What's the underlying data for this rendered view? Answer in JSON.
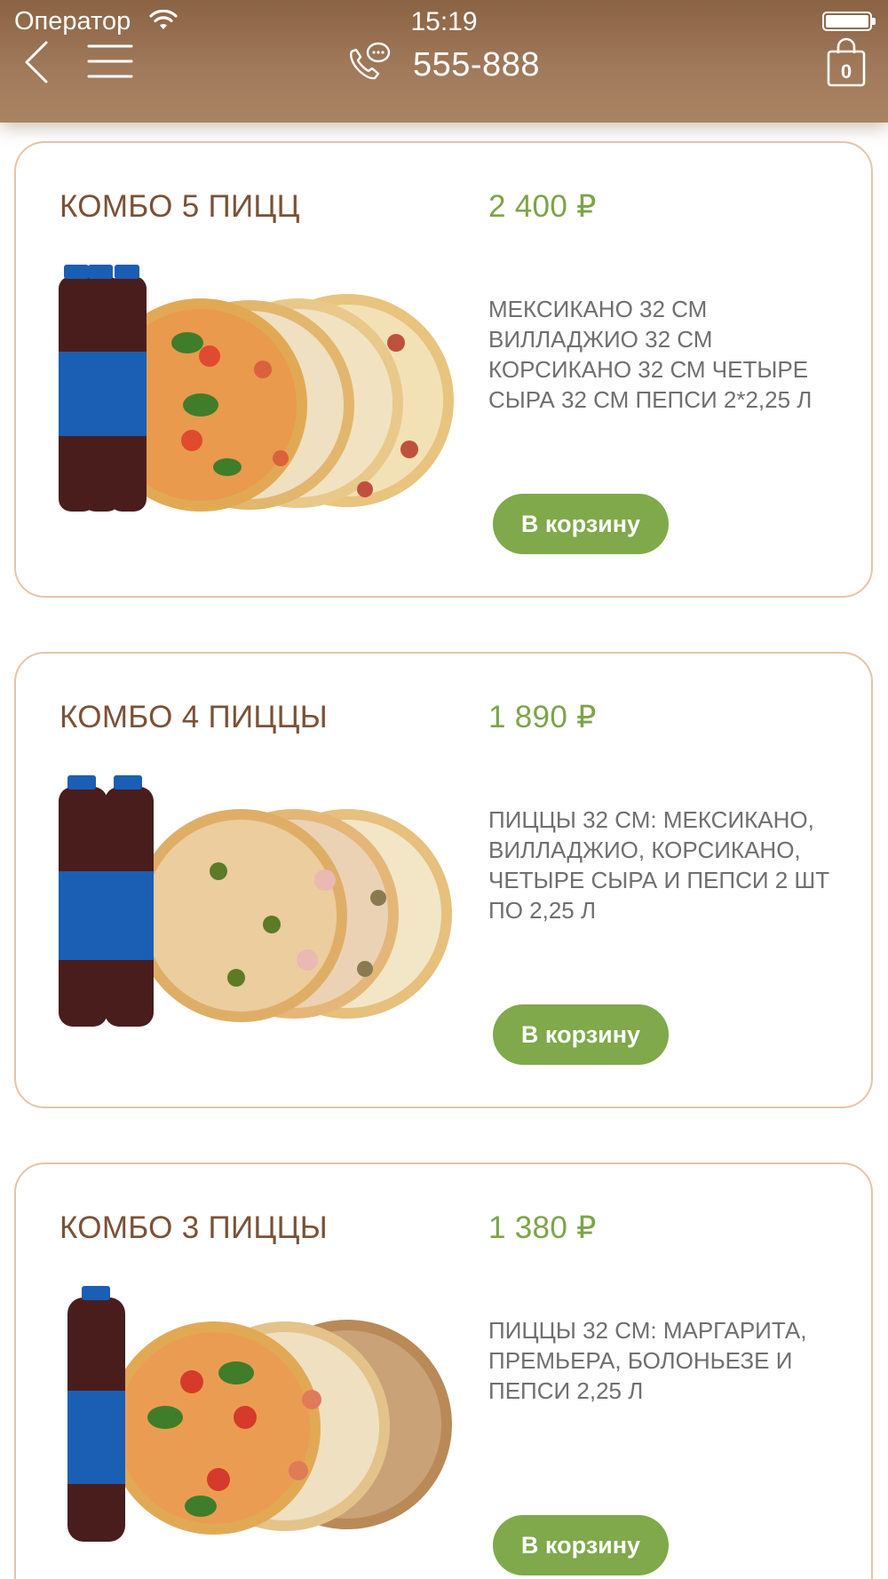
{
  "status_bar": {
    "carrier": "Оператор",
    "time": "15:19"
  },
  "header": {
    "phone": "555-888",
    "cart_count": "0"
  },
  "products": [
    {
      "title": "КОМБО 5 ПИЦЦ",
      "price": "2 400 ₽",
      "description": "МЕКСИКАНО 32 СМ ВИЛЛАДЖИО 32 СМ КОРСИКАНО 32 СМ ЧЕТЫРЕ СЫРА 32 СМ ПЕПСИ 2*2,25 Л",
      "button": "В корзину"
    },
    {
      "title": "КОМБО 4 ПИЦЦЫ",
      "price": "1 890 ₽",
      "description": "ПИЦЦЫ 32 СМ: МЕКСИКАНО, ВИЛЛАДЖИО, КОРСИКАНО, ЧЕТЫРЕ СЫРА И ПЕПСИ 2 ШТ ПО 2,25 Л",
      "button": "В корзину"
    },
    {
      "title": "КОМБО 3 ПИЦЦЫ",
      "price": "1 380 ₽",
      "description": "ПИЦЦЫ 32 СМ: МАРГАРИТА, ПРЕМЬЕРА, БОЛОНЬЕЗЕ И ПЕПСИ 2,25 Л",
      "button": "В корзину"
    }
  ],
  "colors": {
    "header": "#9c7454",
    "title": "#7a5236",
    "price": "#7da448",
    "button": "#7fa94a",
    "card_border": "#e7c4a8"
  },
  "icons": [
    "wifi-icon",
    "battery-icon",
    "back-icon",
    "menu-icon",
    "phone-icon",
    "cart-icon"
  ]
}
